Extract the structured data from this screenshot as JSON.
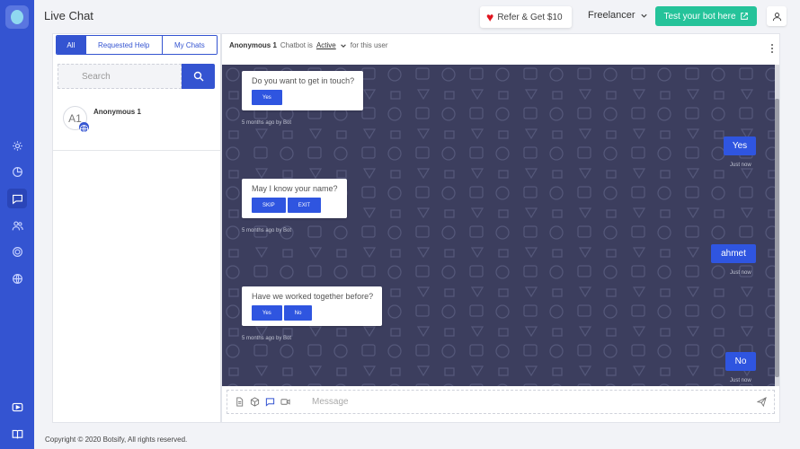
{
  "app": {
    "title": "Live Chat",
    "refer_label": "Refer & Get $10",
    "workspace": "Freelancer",
    "test_bot_label": "Test your bot here"
  },
  "sidebar": {
    "icons": [
      "settings-icon",
      "analytics-icon",
      "chat-icon",
      "users-icon",
      "integrations-icon",
      "globe-icon"
    ],
    "bottom_icons": [
      "video-icon",
      "book-icon"
    ],
    "active": "chat-icon"
  },
  "chat_list": {
    "tabs": [
      {
        "label": "All",
        "active": true
      },
      {
        "label": "Requested Help",
        "active": false
      },
      {
        "label": "My Chats",
        "active": false
      }
    ],
    "search_placeholder": "Search",
    "items": [
      {
        "initials": "A1",
        "name": "Anonymous 1"
      }
    ]
  },
  "conversation": {
    "user": "Anonymous 1",
    "chatbot_text": "Chatbot is",
    "status": "Active",
    "suffix": "for this user",
    "bot_messages": [
      {
        "question": "Do you want to get in touch?",
        "options": [
          "Yes"
        ],
        "meta": "5 months ago by Bot"
      },
      {
        "question": "May I know your name?",
        "options": [
          "SKIP",
          "EXIT"
        ],
        "meta": "5 months ago by Bot"
      },
      {
        "question": "Have we worked together before?",
        "options": [
          "Yes",
          "No"
        ],
        "meta": "5 months ago by Bot"
      }
    ],
    "user_messages": [
      {
        "text": "Yes",
        "meta": "Just now"
      },
      {
        "text": "ahmet",
        "meta": "Just now"
      },
      {
        "text": "No",
        "meta": "Just now"
      }
    ],
    "composer_placeholder": "Message"
  },
  "footer": "Copyright © 2020 Botsify, All rights reserved.",
  "colors": {
    "primary": "#3454d1",
    "accent_green": "#25c39a",
    "chat_bg": "#3c3e5e"
  }
}
